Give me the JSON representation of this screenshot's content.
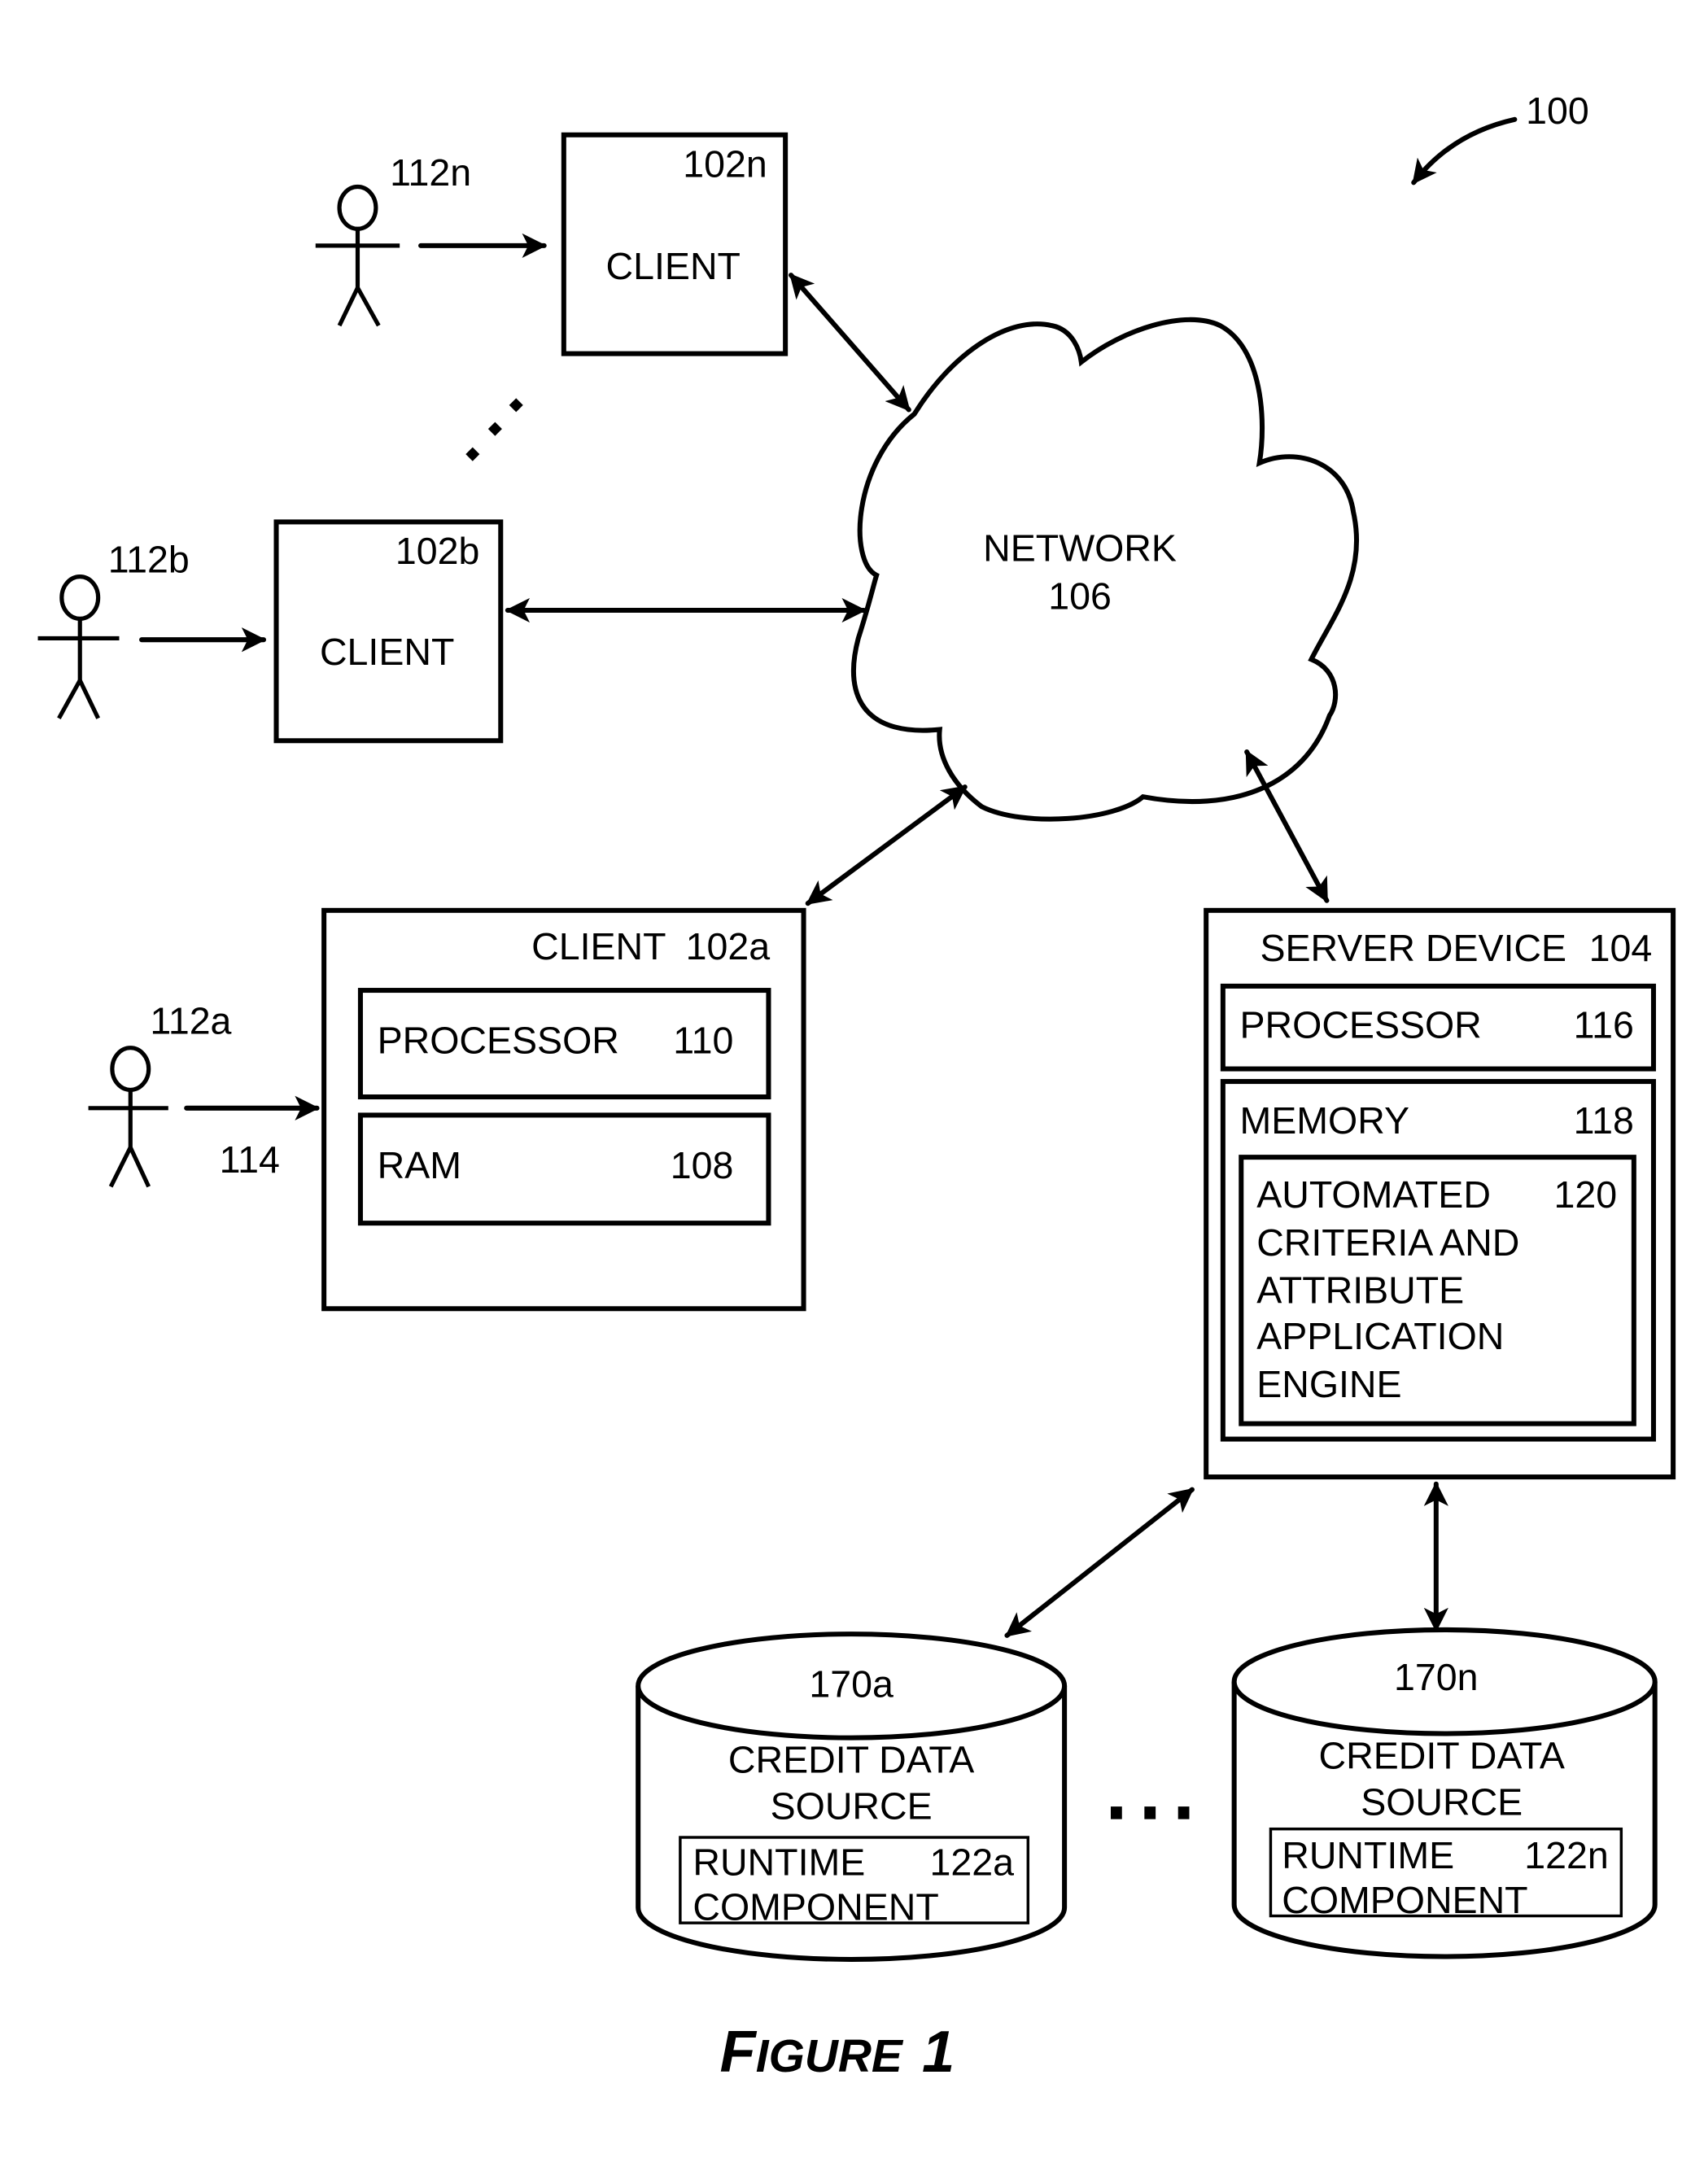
{
  "figure": {
    "reference_numeral": "100",
    "caption_first_letter": "F",
    "caption_rest": "IGURE",
    "caption_number": "1"
  },
  "users": [
    {
      "id": "112n",
      "icon": "stick-figure-icon"
    },
    {
      "id": "112b",
      "icon": "stick-figure-icon"
    },
    {
      "id": "112a",
      "icon": "stick-figure-icon",
      "input_label": "114"
    }
  ],
  "clients": {
    "n": {
      "label": "CLIENT",
      "ref": "102n"
    },
    "b": {
      "label": "CLIENT",
      "ref": "102b"
    },
    "a": {
      "label": "CLIENT",
      "ref": "102a",
      "processor": {
        "label": "PROCESSOR",
        "ref": "110"
      },
      "ram": {
        "label": "RAM",
        "ref": "108"
      }
    }
  },
  "network": {
    "label": "NETWORK",
    "ref": "106",
    "icon": "cloud-icon"
  },
  "server": {
    "label": "SERVER DEVICE",
    "ref": "104",
    "processor": {
      "label": "PROCESSOR",
      "ref": "116"
    },
    "memory": {
      "label": "MEMORY",
      "ref": "118"
    },
    "engine": {
      "ref": "120",
      "lines": [
        "AUTOMATED",
        "CRITERIA AND",
        "ATTRIBUTE",
        "APPLICATION",
        "ENGINE"
      ]
    }
  },
  "data_sources": [
    {
      "ref": "170a",
      "title_lines": [
        "CREDIT DATA",
        "SOURCE"
      ],
      "runtime": {
        "line1": "RUNTIME",
        "line2": "COMPONENT",
        "ref": "122a"
      },
      "icon": "database-cylinder-icon"
    },
    {
      "ref": "170n",
      "title_lines": [
        "CREDIT DATA",
        "SOURCE"
      ],
      "runtime": {
        "line1": "RUNTIME",
        "line2": "COMPONENT",
        "ref": "122n"
      },
      "icon": "database-cylinder-icon"
    }
  ],
  "ellipsis": "..."
}
